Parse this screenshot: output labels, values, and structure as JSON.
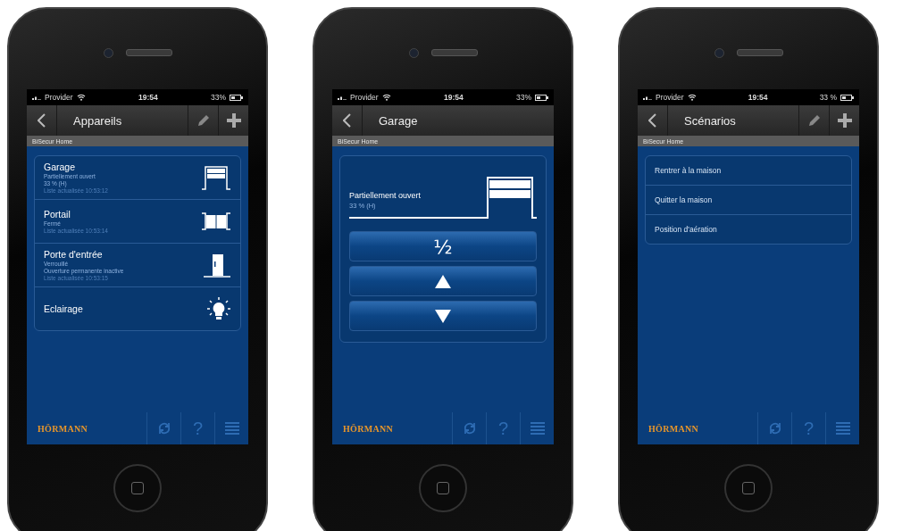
{
  "phones": [
    {
      "status_bar": {
        "carrier": "Provider",
        "time": "19:54",
        "battery": "33%"
      },
      "nav": {
        "title": "Appareils",
        "actions": [
          {
            "kind": "edit"
          },
          {
            "kind": "add"
          }
        ]
      },
      "subheader": "BiSecur Home",
      "content": {
        "kind": "devices",
        "devices": [
          {
            "name": "Garage",
            "kind": "garage",
            "lines": [
              "Partiellement ouvert",
              "33 % (H)"
            ],
            "updated": "Liste actualisée 10:53:12"
          },
          {
            "name": "Portail",
            "kind": "gate",
            "lines": [
              "Fermé"
            ],
            "updated": "Liste actualisée 10:53:14"
          },
          {
            "name": "Porte d'entrée",
            "kind": "door",
            "lines": [
              "Verrouillé",
              "Ouverture permanente inactive"
            ],
            "updated": "Liste actualisée 10:53:15"
          },
          {
            "name": "Eclairage",
            "kind": "bulb"
          }
        ]
      },
      "footer": {
        "brand": "HÖRMANN",
        "help": "?"
      }
    },
    {
      "status_bar": {
        "carrier": "Provider",
        "time": "19:54",
        "battery": "33%"
      },
      "nav": {
        "title": "Garage"
      },
      "subheader": "BiSecur Home",
      "content": {
        "kind": "control",
        "status": "Partiellement ouvert",
        "position": "33 % (H)",
        "buttons": [
          {
            "kind": "text",
            "label": "½"
          },
          {
            "kind": "up"
          },
          {
            "kind": "down"
          }
        ]
      },
      "footer": {
        "brand": "HÖRMANN",
        "help": "?"
      }
    },
    {
      "status_bar": {
        "carrier": "Provider",
        "time": "19:54",
        "battery": "33 %"
      },
      "nav": {
        "title": "Scénarios",
        "actions": [
          {
            "kind": "edit"
          },
          {
            "kind": "add"
          }
        ]
      },
      "subheader": "BiSecur Home",
      "content": {
        "kind": "list",
        "items": [
          "Rentrer à la maison",
          "Quitter la maison",
          "Position d'aération"
        ]
      },
      "footer": {
        "brand": "HÖRMANN",
        "help": "?"
      }
    }
  ]
}
